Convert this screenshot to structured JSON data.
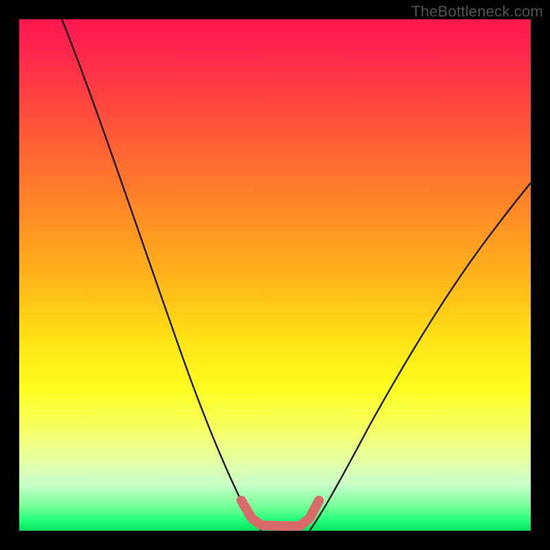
{
  "watermark": "TheBottleneck.com",
  "chart_data": {
    "type": "line",
    "title": "",
    "xlabel": "",
    "ylabel": "",
    "xlim": [
      0,
      100
    ],
    "ylim": [
      0,
      100
    ],
    "series": [
      {
        "name": "left-curve",
        "x": [
          9,
          12,
          15,
          18,
          21,
          24,
          27,
          30,
          33,
          36,
          39,
          42,
          44,
          46,
          47
        ],
        "y": [
          100,
          92,
          84,
          76,
          68,
          60,
          52,
          44,
          36,
          28,
          20,
          12,
          6,
          2,
          0
        ]
      },
      {
        "name": "right-curve",
        "x": [
          57,
          60,
          64,
          68,
          72,
          76,
          80,
          84,
          88,
          92,
          96,
          100
        ],
        "y": [
          0,
          3,
          8,
          14,
          21,
          28,
          35,
          42,
          49,
          56,
          62,
          68
        ]
      },
      {
        "name": "valley-marker",
        "x": [
          44,
          46,
          48,
          51,
          54,
          57,
          59
        ],
        "y": [
          6,
          2,
          0.5,
          0.5,
          0.5,
          2,
          6
        ]
      }
    ],
    "colors": {
      "gradient_top": "#ff1650",
      "gradient_bottom": "#00e060",
      "curve": "#000000",
      "marker": "#d96a6a",
      "frame": "#000000"
    }
  }
}
